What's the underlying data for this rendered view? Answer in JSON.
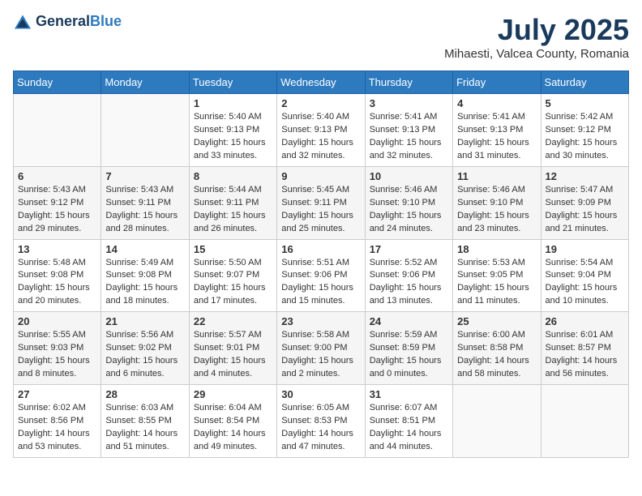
{
  "header": {
    "logo_general": "General",
    "logo_blue": "Blue",
    "month_year": "July 2025",
    "location": "Mihaesti, Valcea County, Romania"
  },
  "weekdays": [
    "Sunday",
    "Monday",
    "Tuesday",
    "Wednesday",
    "Thursday",
    "Friday",
    "Saturday"
  ],
  "weeks": [
    [
      {
        "day": "",
        "info": ""
      },
      {
        "day": "",
        "info": ""
      },
      {
        "day": "1",
        "info": "Sunrise: 5:40 AM\nSunset: 9:13 PM\nDaylight: 15 hours and 33 minutes."
      },
      {
        "day": "2",
        "info": "Sunrise: 5:40 AM\nSunset: 9:13 PM\nDaylight: 15 hours and 32 minutes."
      },
      {
        "day": "3",
        "info": "Sunrise: 5:41 AM\nSunset: 9:13 PM\nDaylight: 15 hours and 32 minutes."
      },
      {
        "day": "4",
        "info": "Sunrise: 5:41 AM\nSunset: 9:13 PM\nDaylight: 15 hours and 31 minutes."
      },
      {
        "day": "5",
        "info": "Sunrise: 5:42 AM\nSunset: 9:12 PM\nDaylight: 15 hours and 30 minutes."
      }
    ],
    [
      {
        "day": "6",
        "info": "Sunrise: 5:43 AM\nSunset: 9:12 PM\nDaylight: 15 hours and 29 minutes."
      },
      {
        "day": "7",
        "info": "Sunrise: 5:43 AM\nSunset: 9:11 PM\nDaylight: 15 hours and 28 minutes."
      },
      {
        "day": "8",
        "info": "Sunrise: 5:44 AM\nSunset: 9:11 PM\nDaylight: 15 hours and 26 minutes."
      },
      {
        "day": "9",
        "info": "Sunrise: 5:45 AM\nSunset: 9:11 PM\nDaylight: 15 hours and 25 minutes."
      },
      {
        "day": "10",
        "info": "Sunrise: 5:46 AM\nSunset: 9:10 PM\nDaylight: 15 hours and 24 minutes."
      },
      {
        "day": "11",
        "info": "Sunrise: 5:46 AM\nSunset: 9:10 PM\nDaylight: 15 hours and 23 minutes."
      },
      {
        "day": "12",
        "info": "Sunrise: 5:47 AM\nSunset: 9:09 PM\nDaylight: 15 hours and 21 minutes."
      }
    ],
    [
      {
        "day": "13",
        "info": "Sunrise: 5:48 AM\nSunset: 9:08 PM\nDaylight: 15 hours and 20 minutes."
      },
      {
        "day": "14",
        "info": "Sunrise: 5:49 AM\nSunset: 9:08 PM\nDaylight: 15 hours and 18 minutes."
      },
      {
        "day": "15",
        "info": "Sunrise: 5:50 AM\nSunset: 9:07 PM\nDaylight: 15 hours and 17 minutes."
      },
      {
        "day": "16",
        "info": "Sunrise: 5:51 AM\nSunset: 9:06 PM\nDaylight: 15 hours and 15 minutes."
      },
      {
        "day": "17",
        "info": "Sunrise: 5:52 AM\nSunset: 9:06 PM\nDaylight: 15 hours and 13 minutes."
      },
      {
        "day": "18",
        "info": "Sunrise: 5:53 AM\nSunset: 9:05 PM\nDaylight: 15 hours and 11 minutes."
      },
      {
        "day": "19",
        "info": "Sunrise: 5:54 AM\nSunset: 9:04 PM\nDaylight: 15 hours and 10 minutes."
      }
    ],
    [
      {
        "day": "20",
        "info": "Sunrise: 5:55 AM\nSunset: 9:03 PM\nDaylight: 15 hours and 8 minutes."
      },
      {
        "day": "21",
        "info": "Sunrise: 5:56 AM\nSunset: 9:02 PM\nDaylight: 15 hours and 6 minutes."
      },
      {
        "day": "22",
        "info": "Sunrise: 5:57 AM\nSunset: 9:01 PM\nDaylight: 15 hours and 4 minutes."
      },
      {
        "day": "23",
        "info": "Sunrise: 5:58 AM\nSunset: 9:00 PM\nDaylight: 15 hours and 2 minutes."
      },
      {
        "day": "24",
        "info": "Sunrise: 5:59 AM\nSunset: 8:59 PM\nDaylight: 15 hours and 0 minutes."
      },
      {
        "day": "25",
        "info": "Sunrise: 6:00 AM\nSunset: 8:58 PM\nDaylight: 14 hours and 58 minutes."
      },
      {
        "day": "26",
        "info": "Sunrise: 6:01 AM\nSunset: 8:57 PM\nDaylight: 14 hours and 56 minutes."
      }
    ],
    [
      {
        "day": "27",
        "info": "Sunrise: 6:02 AM\nSunset: 8:56 PM\nDaylight: 14 hours and 53 minutes."
      },
      {
        "day": "28",
        "info": "Sunrise: 6:03 AM\nSunset: 8:55 PM\nDaylight: 14 hours and 51 minutes."
      },
      {
        "day": "29",
        "info": "Sunrise: 6:04 AM\nSunset: 8:54 PM\nDaylight: 14 hours and 49 minutes."
      },
      {
        "day": "30",
        "info": "Sunrise: 6:05 AM\nSunset: 8:53 PM\nDaylight: 14 hours and 47 minutes."
      },
      {
        "day": "31",
        "info": "Sunrise: 6:07 AM\nSunset: 8:51 PM\nDaylight: 14 hours and 44 minutes."
      },
      {
        "day": "",
        "info": ""
      },
      {
        "day": "",
        "info": ""
      }
    ]
  ]
}
